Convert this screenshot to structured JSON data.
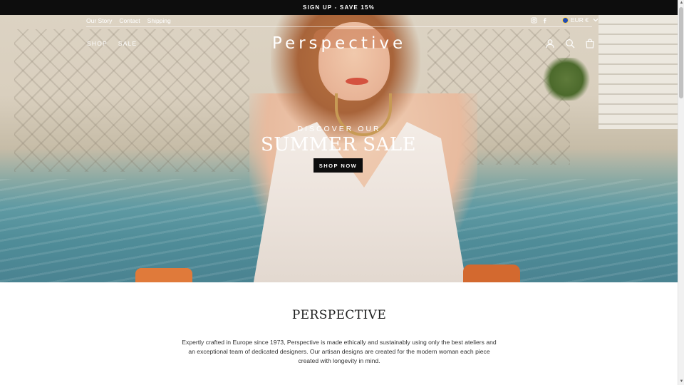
{
  "announcement": {
    "text": "SIGN UP - SAVE 15%"
  },
  "header": {
    "util_links": [
      "Our Story",
      "Contact",
      "Shipping"
    ],
    "social": [
      "instagram-icon",
      "facebook-icon"
    ],
    "currency": {
      "label": "EUR €"
    },
    "nav": [
      "SHOP",
      "SALE"
    ],
    "logo": "Perspective",
    "icons": [
      "account-icon",
      "search-icon",
      "cart-icon"
    ]
  },
  "hero": {
    "kicker": "DISCOVER OUR",
    "title": "SUMMER SALE",
    "cta": "SHOP NOW"
  },
  "about": {
    "title": "PERSPECTIVE",
    "text": "Expertly crafted in Europe since 1973, Perspective is made ethically and sustainably using only the best ateliers and an exceptional team of dedicated designers. Our artisan designs are created for the modern woman each piece created with longevity in mind."
  },
  "colors": {
    "announcement_bg": "#0d0d0d",
    "cta_bg": "#0d0d0d",
    "text": "#1c1d1d"
  }
}
